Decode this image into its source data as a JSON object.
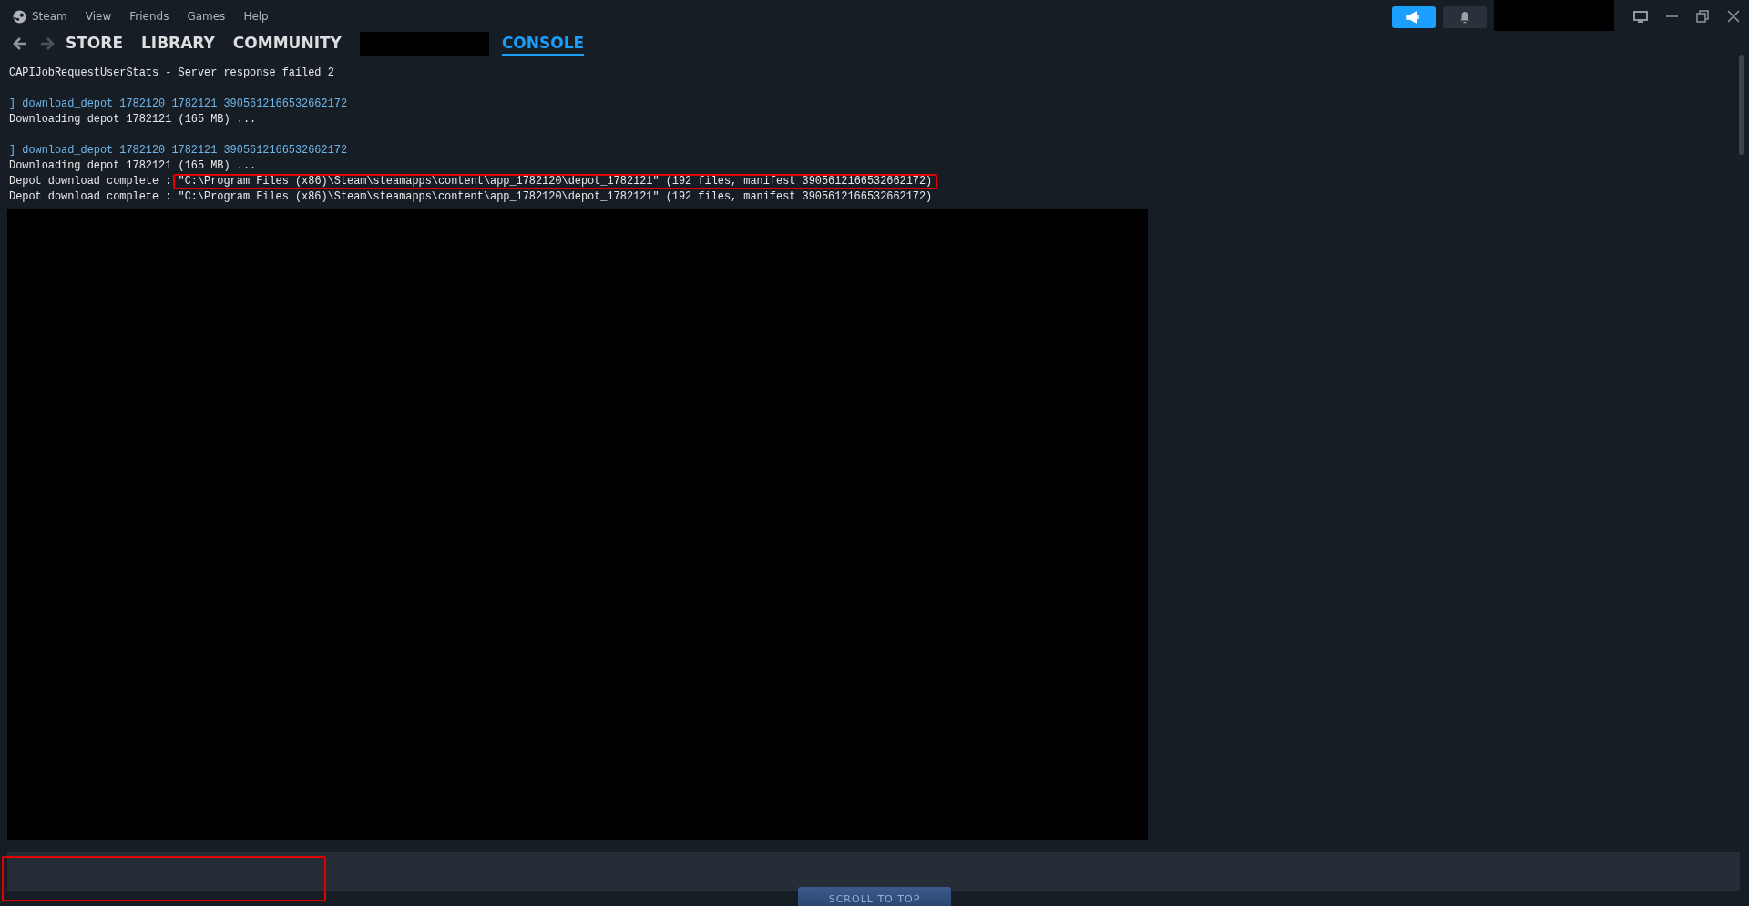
{
  "menu": [
    "Steam",
    "View",
    "Friends",
    "Games",
    "Help"
  ],
  "nav": [
    {
      "kind": "tab",
      "label": "STORE",
      "selected": false
    },
    {
      "kind": "tab",
      "label": "LIBRARY",
      "selected": false
    },
    {
      "kind": "tab",
      "label": "COMMUNITY",
      "selected": false
    },
    {
      "kind": "redacted"
    },
    {
      "kind": "tab",
      "label": "CONSOLE",
      "selected": true
    }
  ],
  "console": {
    "blocks": [
      {
        "lines": [
          {
            "kind": "output",
            "text": "CAPIJobRequestUserStats - Server response failed 2"
          }
        ]
      },
      {
        "lines": [
          {
            "kind": "command",
            "text": "] download_depot 1782120 1782121 3905612166532662172"
          },
          {
            "kind": "output",
            "text": "Downloading depot 1782121 (165 MB) ..."
          }
        ]
      },
      {
        "lines": [
          {
            "kind": "command",
            "text": "] download_depot 1782120 1782121 3905612166532662172"
          },
          {
            "kind": "output",
            "text": "Downloading depot 1782121 (165 MB) ..."
          },
          {
            "kind": "output",
            "text": "Depot download complete : ",
            "highlighted": "\"C:\\Program Files (x86)\\Steam\\steamapps\\content\\app_1782120\\depot_1782121\" (192 files, manifest 3905612166532662172)"
          },
          {
            "kind": "output",
            "text": "Depot download complete : \"C:\\Program Files (x86)\\Steam\\steamapps\\content\\app_1782120\\depot_1782121\" (192 files, manifest 3905612166532662172)"
          }
        ]
      }
    ]
  },
  "input": {
    "highlighted": true
  },
  "scroll_to_top": "SCROLL TO TOP"
}
